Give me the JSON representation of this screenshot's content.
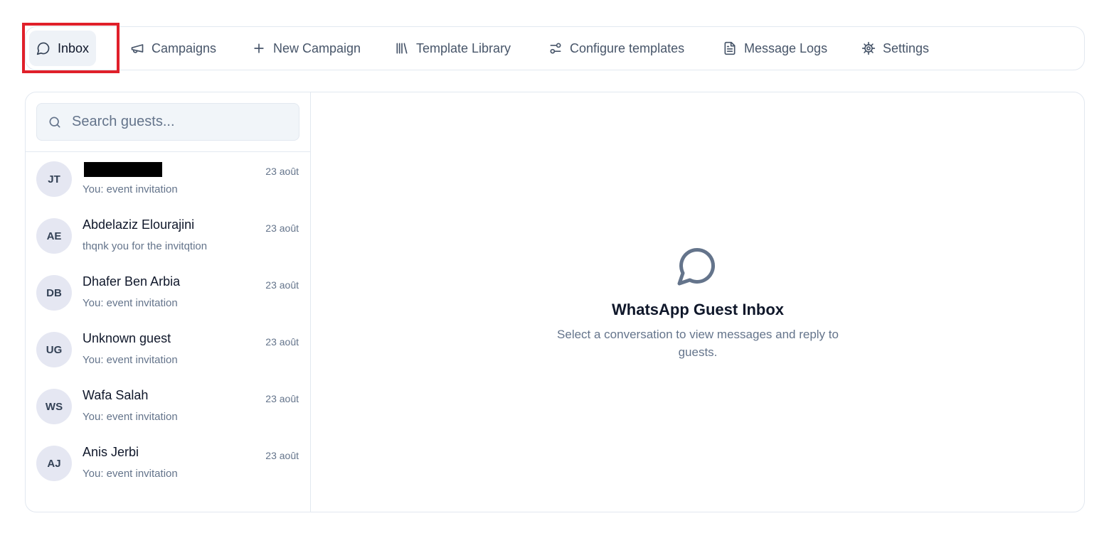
{
  "nav": {
    "items": [
      {
        "label": "Inbox",
        "icon": "chat-bubble-icon",
        "active": true
      },
      {
        "label": "Campaigns",
        "icon": "megaphone-icon"
      },
      {
        "label": "New Campaign",
        "icon": "plus-icon"
      },
      {
        "label": "Template Library",
        "icon": "library-icon"
      },
      {
        "label": "Configure templates",
        "icon": "sliders-icon"
      },
      {
        "label": "Message Logs",
        "icon": "document-icon"
      },
      {
        "label": "Settings",
        "icon": "gear-icon"
      }
    ]
  },
  "search": {
    "placeholder": "Search guests...",
    "icon": "search-icon"
  },
  "conversations": [
    {
      "initials": "JT",
      "name": "",
      "name_redacted": true,
      "preview": "You: event invitation",
      "date": "23 août"
    },
    {
      "initials": "AE",
      "name": "Abdelaziz Elourajini",
      "preview": "thqnk you for the invitqtion",
      "date": "23 août"
    },
    {
      "initials": "DB",
      "name": "Dhafer Ben Arbia",
      "preview": "You: event invitation",
      "date": "23 août"
    },
    {
      "initials": "UG",
      "name": "Unknown guest",
      "preview": "You: event invitation",
      "date": "23 août"
    },
    {
      "initials": "WS",
      "name": "Wafa Salah",
      "preview": "You: event invitation",
      "date": "23 août"
    },
    {
      "initials": "AJ",
      "name": "Anis Jerbi",
      "preview": "You: event invitation",
      "date": "23 août"
    }
  ],
  "empty_state": {
    "icon": "chat-bubble-icon",
    "title": "WhatsApp Guest Inbox",
    "text": "Select a conversation to view messages and reply to guests."
  },
  "colors": {
    "highlight": "#e0202a",
    "active_tab_bg": "#eef2f7",
    "avatar_bg": "#e5e7f2",
    "muted_text": "#64748b"
  }
}
